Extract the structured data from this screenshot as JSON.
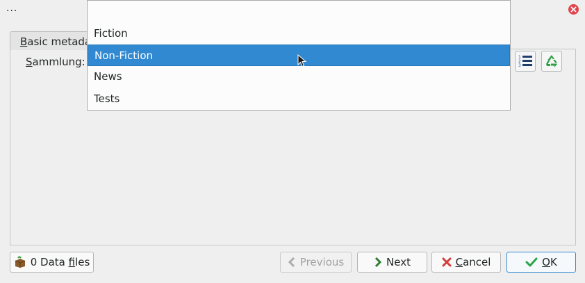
{
  "window": {
    "title": "...",
    "close_icon": "close-icon"
  },
  "tab": {
    "label_prefix": "B",
    "label_rest": "asic metadat"
  },
  "field": {
    "label_prefix": "S",
    "label_rest": "ammlung:"
  },
  "dropdown": {
    "items": [
      "",
      "Fiction",
      "Non-Fiction",
      "News",
      "Tests"
    ],
    "selected_index": 2
  },
  "toolbar": {
    "list_icon": "numbered-list-icon",
    "recycle_icon": "recycle-icon"
  },
  "footer": {
    "data_files_label_a": "0 Data ",
    "data_files_label_u": "f",
    "data_files_label_b": "iles",
    "previous_label": "Previous",
    "next_label": "Next",
    "cancel_label_u": "C",
    "cancel_label_rest": "ancel",
    "ok_label_u": "O",
    "ok_label_rest": "K"
  },
  "colors": {
    "selection": "#3089d1",
    "cancel_x": "#d63a3a",
    "ok_check": "#27a547",
    "next_arrow": "#2e7d32"
  }
}
